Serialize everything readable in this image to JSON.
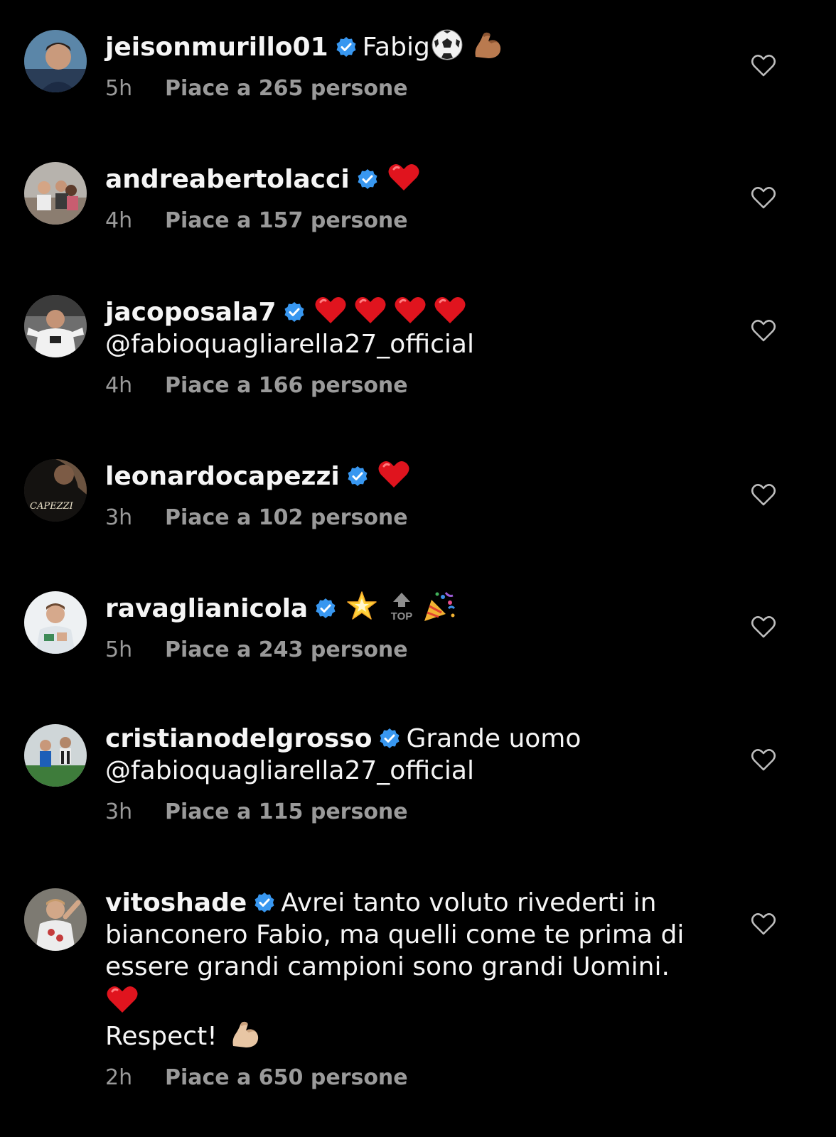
{
  "comments": [
    {
      "username": "jeisonmurillo01",
      "text": "Fabig",
      "time": "5h",
      "likes": "Piace a 265 persone"
    },
    {
      "username": "andreabertolacci",
      "text": "",
      "time": "4h",
      "likes": "Piace a 157 persone"
    },
    {
      "username": "jacoposala7",
      "text": "",
      "mention": "@fabioquagliarella27_official",
      "time": "4h",
      "likes": "Piace a 166 persone"
    },
    {
      "username": "leonardocapezzi",
      "text": "",
      "avatar_text": "CAPEZZI",
      "time": "3h",
      "likes": "Piace a 102 persone"
    },
    {
      "username": "ravaglianicola",
      "text": "",
      "top_label": "TOP",
      "time": "5h",
      "likes": "Piace a 243 persone"
    },
    {
      "username": "cristianodelgrosso",
      "text": "Grande uomo",
      "mention": "@fabioquagliarella27_official",
      "time": "3h",
      "likes": "Piace a 115 persone"
    },
    {
      "username": "vitoshade",
      "text": "Avrei tanto voluto rivederti in bianconero Fabio, ma quelli come te prima di essere grandi campioni sono grandi Uomini.",
      "text2": "Respect!",
      "time": "2h",
      "likes": "Piace a 650 persone"
    }
  ],
  "colors": {
    "background": "#000000",
    "text": "#f5f5f5",
    "meta": "#9a9a9a",
    "verified": "#3897f0",
    "heart_red": "#e0141e"
  },
  "icons": {
    "verified": "verified-badge-icon",
    "like": "heart-outline-icon",
    "soccer": "soccer-ball-icon",
    "flex": "flexed-biceps-icon",
    "red_heart": "red-heart-icon",
    "star": "glowing-star-icon",
    "top": "top-arrow-icon",
    "party": "party-popper-icon"
  }
}
